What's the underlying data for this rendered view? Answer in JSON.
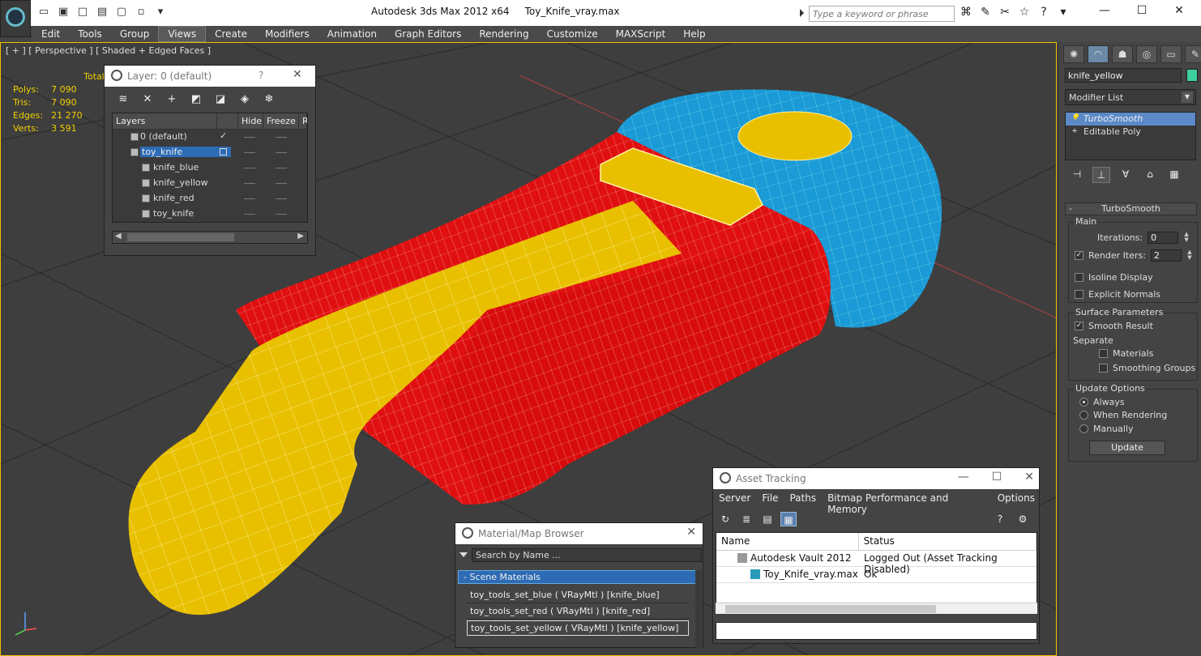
{
  "title": {
    "app": "Autodesk 3ds Max  2012 x64",
    "file": "Toy_Knife_vray.max"
  },
  "search": {
    "placeholder": "Type a keyword or phrase"
  },
  "menu": [
    "Edit",
    "Tools",
    "Group",
    "Views",
    "Create",
    "Modifiers",
    "Animation",
    "Graph Editors",
    "Rendering",
    "Customize",
    "MAXScript",
    "Help"
  ],
  "menu_active": "Views",
  "viewport": {
    "label": "[ + ] [ Perspective ] [ Shaded + Edged Faces ]",
    "stats": {
      "header": "Total",
      "rows": [
        [
          "Polys:",
          "7 090"
        ],
        [
          "Tris:",
          "7 090"
        ],
        [
          "Edges:",
          "21 270"
        ],
        [
          "Verts:",
          "3 591"
        ]
      ]
    }
  },
  "layer_dialog": {
    "title": "Layer: 0 (default)",
    "help": "?",
    "columns": [
      "Layers",
      "Hide",
      "Freeze",
      "R"
    ],
    "rows": [
      {
        "name": "0 (default)",
        "indent": 0
      },
      {
        "name": "toy_knife",
        "indent": 0,
        "selected": true
      },
      {
        "name": "knife_blue",
        "indent": 1
      },
      {
        "name": "knife_yellow",
        "indent": 1
      },
      {
        "name": "knife_red",
        "indent": 1
      },
      {
        "name": "toy_knife",
        "indent": 1
      }
    ]
  },
  "command_panel": {
    "object_name": "knife_yellow",
    "object_color": "#3ccfa0",
    "modifier_list": "Modifier List",
    "stack": [
      "TurboSmooth",
      "Editable Poly"
    ],
    "rollout": "TurboSmooth",
    "main": {
      "label": "Main",
      "iterations_label": "Iterations:",
      "iterations": "0",
      "render_iters_label": "Render Iters:",
      "render_iters": "2",
      "isoline": "Isoline Display",
      "explicit": "Explicit Normals"
    },
    "surface": {
      "label": "Surface Parameters",
      "smooth": "Smooth Result",
      "separate": "Separate",
      "materials": "Materials",
      "smoothing": "Smoothing Groups"
    },
    "update": {
      "label": "Update Options",
      "always": "Always",
      "when_rendering": "When Rendering",
      "manually": "Manually",
      "button": "Update"
    }
  },
  "material_browser": {
    "title": "Material/Map Browser",
    "search": "Search by Name ...",
    "section": "- Scene Materials",
    "items": [
      "toy_tools_set_blue  ( VRayMtl ) [knife_blue]",
      "toy_tools_set_red  ( VRayMtl ) [knife_red]",
      "toy_tools_set_yellow  ( VRayMtl ) [knife_yellow]"
    ]
  },
  "asset_tracking": {
    "title": "Asset Tracking",
    "menu": [
      "Server",
      "File",
      "Paths",
      "Bitmap Performance and Memory",
      "Options"
    ],
    "columns": [
      "Name",
      "Status"
    ],
    "rows": [
      {
        "name": "Autodesk Vault 2012",
        "status": "Logged Out (Asset Tracking Disabled)"
      },
      {
        "name": "Toy_Knife_vray.max",
        "status": "Ok"
      }
    ]
  },
  "colors": {
    "blue": "#1a9ad6",
    "red": "#e01010",
    "yellow": "#e8c000",
    "wire": "#3ccfcf"
  }
}
